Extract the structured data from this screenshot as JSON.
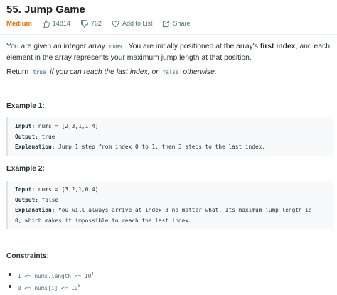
{
  "problem": {
    "title": "55. Jump Game",
    "difficulty": "Medium",
    "likes": "14814",
    "dislikes": "762",
    "add_to_list": "Add to List",
    "share": "Share"
  },
  "description": {
    "part1": "You are given an integer array ",
    "code_nums": "nums",
    "part2": ". You are initially positioned at the array's ",
    "bold": "first index",
    "part3": ", and each element in the array represents your maximum jump length at that position.",
    "return_prefix": "Return ",
    "code_true": "true",
    "italic1": " if you can reach the last index, or ",
    "code_false": "false",
    "italic2": " otherwise."
  },
  "examples": [
    {
      "title": "Example 1:",
      "input_label": "Input:",
      "input_value": " nums = [2,3,1,1,4]",
      "output_label": "Output:",
      "output_value": " true",
      "explanation_label": "Explanation:",
      "explanation_value": " Jump 1 step from index 0 to 1, then 3 steps to the last index."
    },
    {
      "title": "Example 2:",
      "input_label": "Input:",
      "input_value": " nums = [3,2,1,0,4]",
      "output_label": "Output:",
      "output_value": " false",
      "explanation_label": "Explanation:",
      "explanation_value": " You will always arrive at index 3 no matter what. Its maximum jump length is",
      "explanation_value2": "0, which makes it impossible to reach the last index."
    }
  ],
  "constraints": {
    "title": "Constraints:",
    "items": [
      {
        "text": "1 <= nums.length <= 10",
        "exponent": "4"
      },
      {
        "text": "0 <= nums[i] <= 10",
        "exponent": "5"
      }
    ]
  },
  "colors": {
    "difficulty_medium": "#ef6c00",
    "text": "#263238",
    "muted": "#546e7a",
    "code_bg": "#f7f9fa"
  },
  "icons": [
    "thumbs-up-icon",
    "thumbs-down-icon",
    "heart-icon",
    "share-icon"
  ]
}
